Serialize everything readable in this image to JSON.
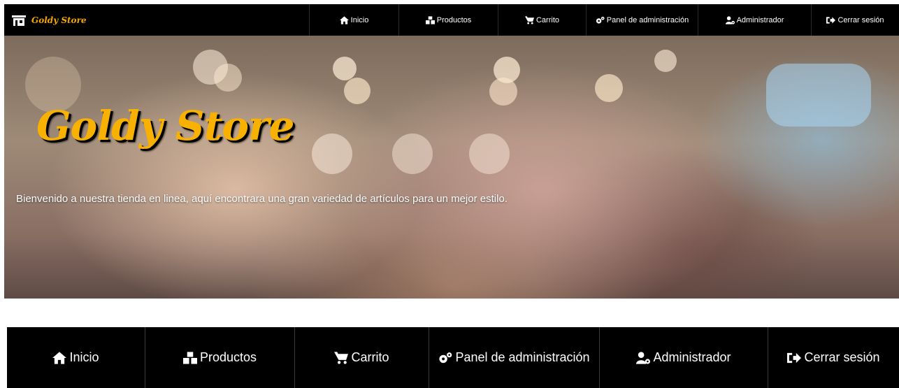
{
  "brand": {
    "name": "Goldy Store",
    "icon": "store-icon"
  },
  "nav": {
    "items": [
      {
        "label": "Inicio",
        "icon": "home-icon"
      },
      {
        "label": "Productos",
        "icon": "cubes-icon"
      },
      {
        "label": "Carrito",
        "icon": "cart-icon"
      },
      {
        "label": "Panel de administración",
        "icon": "cogs-icon"
      },
      {
        "label": "Administrador",
        "icon": "user-cog-icon"
      },
      {
        "label": "Cerrar sesión",
        "icon": "sign-out-icon"
      }
    ]
  },
  "hero": {
    "title": "Goldy Store",
    "description": "Bienvenido a nuestra tienda en linea, aquí encontrara una gran variedad de artículos para un mejor estilo."
  },
  "colors": {
    "accent": "#f8b100",
    "navbar": "#000000",
    "text": "#ffffff"
  }
}
